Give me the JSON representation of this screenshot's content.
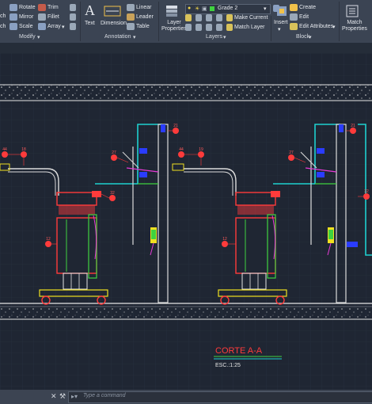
{
  "ribbon": {
    "modify": {
      "title": "Modify",
      "items": [
        "Rotate",
        "Trim",
        "Mirror",
        "Fillet",
        "Scale",
        "Array"
      ],
      "cut_label": "ch"
    },
    "annotation": {
      "title": "Annotation",
      "text_label": "Text",
      "dimension_label": "Dimension",
      "linear_label": "Linear",
      "leader_label": "Leader",
      "table_label": "Table"
    },
    "layers": {
      "title": "Layers",
      "layer_properties_label": "Layer\nProperties",
      "current_layer": "Grade 2",
      "make_current_label": "Make Current",
      "match_layer_label": "Match Layer"
    },
    "block": {
      "title": "Block",
      "insert_label": "Insert",
      "create_label": "Create",
      "edit_label": "Edit",
      "edit_attributes_label": "Edit Attributes"
    },
    "properties": {
      "match_properties_label": "Match\nProperties"
    }
  },
  "drawing": {
    "section_title": "CORTE  A-A",
    "scale_text": "ESC.:1:25",
    "callouts": [
      "44",
      "18",
      "27",
      "21",
      "32",
      "12",
      "44",
      "19",
      "27",
      "21",
      "32",
      "12"
    ]
  },
  "command": {
    "placeholder": "Type a command"
  },
  "colors": {
    "ribbon_bg": "#3b4453",
    "canvas_bg": "#1f2633",
    "cyan": "#1fd0d0",
    "red": "#ff3b3b",
    "green": "#3fd23f",
    "blue": "#2a3cff",
    "magenta": "#e63bd6",
    "yellow": "#f0e020"
  }
}
